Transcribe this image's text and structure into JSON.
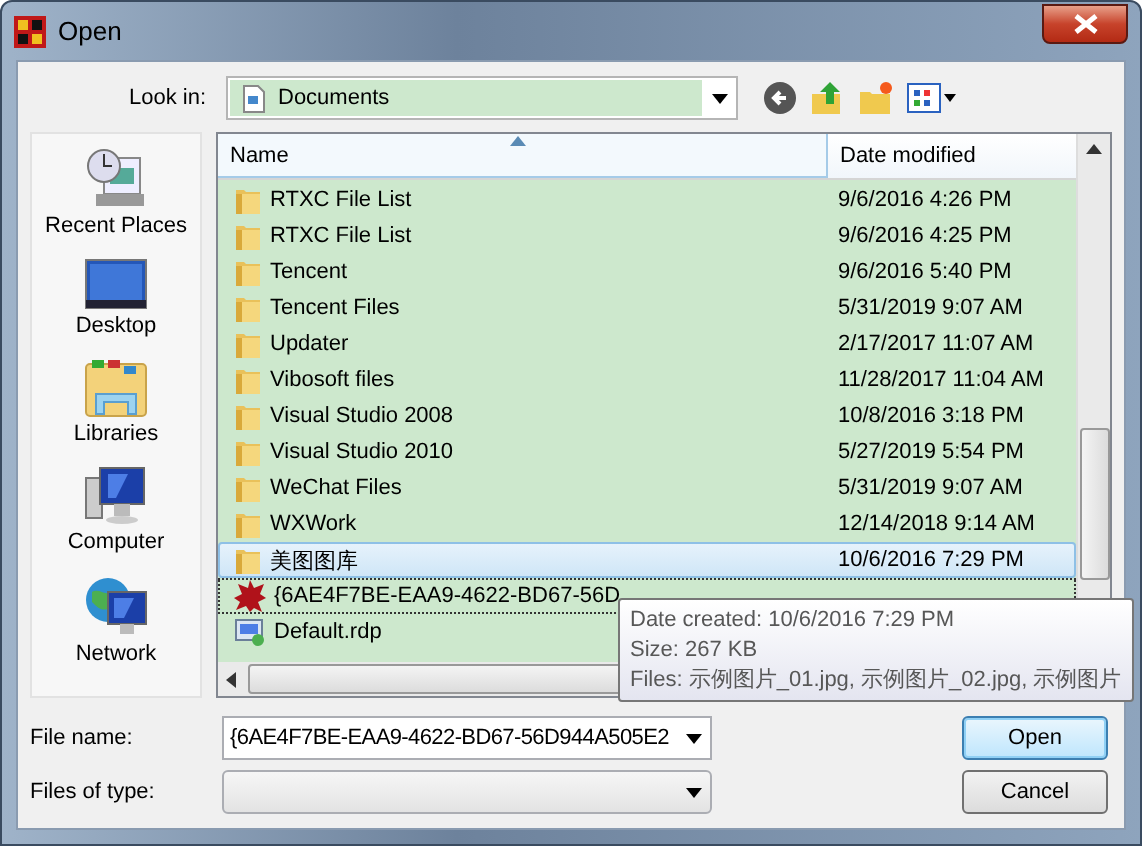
{
  "window": {
    "title": "Open"
  },
  "look_in": {
    "label": "Look in:",
    "value": "Documents"
  },
  "sidebar": {
    "items": [
      {
        "label": "Recent Places",
        "kind": "recent"
      },
      {
        "label": "Desktop",
        "kind": "desktop"
      },
      {
        "label": "Libraries",
        "kind": "libraries"
      },
      {
        "label": "Computer",
        "kind": "computer"
      },
      {
        "label": "Network",
        "kind": "network"
      }
    ]
  },
  "file_list": {
    "columns": [
      "Name",
      "Date modified"
    ],
    "rows": [
      {
        "name": "RTXC File List",
        "date": "9/6/2016 4:26 PM",
        "kind": "folder",
        "selected": false,
        "focused": false
      },
      {
        "name": "RTXC File List",
        "date": "9/6/2016 4:25 PM",
        "kind": "folder",
        "selected": false,
        "focused": false
      },
      {
        "name": "Tencent",
        "date": "9/6/2016 5:40 PM",
        "kind": "folder",
        "selected": false,
        "focused": false
      },
      {
        "name": "Tencent Files",
        "date": "5/31/2019 9:07 AM",
        "kind": "folder",
        "selected": false,
        "focused": false
      },
      {
        "name": "Updater",
        "date": "2/17/2017 11:07 AM",
        "kind": "folder",
        "selected": false,
        "focused": false
      },
      {
        "name": "Vibosoft files",
        "date": "11/28/2017 11:04 AM",
        "kind": "folder",
        "selected": false,
        "focused": false
      },
      {
        "name": "Visual Studio 2008",
        "date": "10/8/2016 3:18 PM",
        "kind": "folder",
        "selected": false,
        "focused": false
      },
      {
        "name": "Visual Studio 2010",
        "date": "5/27/2019 5:54 PM",
        "kind": "folder",
        "selected": false,
        "focused": false
      },
      {
        "name": "WeChat Files",
        "date": "5/31/2019 9:07 AM",
        "kind": "folder",
        "selected": false,
        "focused": false
      },
      {
        "name": "WXWork",
        "date": "12/14/2018 9:14 AM",
        "kind": "folder",
        "selected": false,
        "focused": false
      },
      {
        "name": "美图图库",
        "date": "10/6/2016 7:29 PM",
        "kind": "folder",
        "selected": true,
        "focused": false
      },
      {
        "name": "{6AE4F7BE-EAA9-4622-BD67-56D",
        "kind": "image",
        "selected": false,
        "focused": true
      },
      {
        "name": "Default.rdp",
        "kind": "rdp",
        "selected": false,
        "focused": false
      }
    ]
  },
  "tooltip": {
    "lines": [
      "Date created: 10/6/2016 7:29 PM",
      "Size: 267 KB",
      "Files: 示例图片_01.jpg, 示例图片_02.jpg, 示例图片"
    ]
  },
  "file_name": {
    "label": "File name:",
    "value": "{6AE4F7BE-EAA9-4622-BD67-56D944A505E2"
  },
  "file_type": {
    "label": "Files of type:"
  },
  "buttons": [
    {
      "label": "Open",
      "kind": "default"
    },
    {
      "label": "Cancel",
      "kind": "normal"
    }
  ]
}
